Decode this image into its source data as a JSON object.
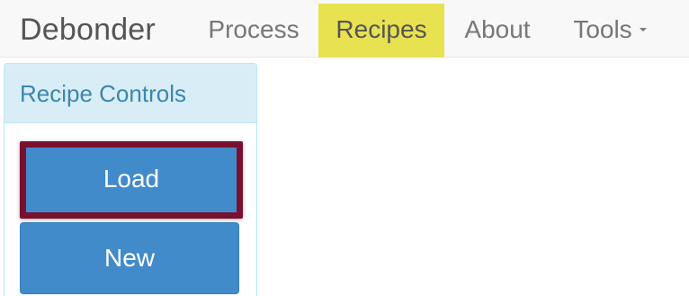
{
  "navbar": {
    "brand": "Debonder",
    "items": [
      {
        "label": "Process",
        "active": false
      },
      {
        "label": "Recipes",
        "active": true
      },
      {
        "label": "About",
        "active": false
      },
      {
        "label": "Tools",
        "active": false,
        "dropdown": true
      }
    ],
    "active_highlight_color": "#e8e150"
  },
  "panel": {
    "title": "Recipe Controls",
    "buttons": {
      "load_label": "Load",
      "new_label": "New"
    },
    "highlight_border_color": "#7a1030",
    "button_color": "#428bca"
  }
}
